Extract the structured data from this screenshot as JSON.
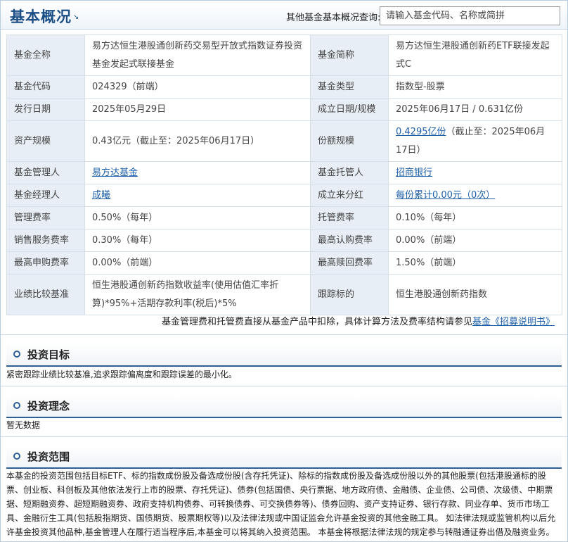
{
  "header": {
    "title": "基本概况",
    "title_arrow": "↘",
    "query_label": "其他基金基本概况查询:",
    "search_placeholder": "请输入基金代码、名称或简拼"
  },
  "info": {
    "full_name_label": "基金全称",
    "full_name": "易方达恒生港股通创新药交易型开放式指数证券投资基金发起式联接基金",
    "short_name_label": "基金简称",
    "short_name": "易方达恒生港股通创新药ETF联接发起式C",
    "code_label": "基金代码",
    "code": "024329（前端）",
    "type_label": "基金类型",
    "type": "指数型-股票",
    "issue_date_label": "发行日期",
    "issue_date": "2025年05月29日",
    "establish_label": "成立日期/规模",
    "establish": "2025年06月17日 / 0.631亿份",
    "asset_label": "资产规模",
    "asset": "0.43亿元（截止至：2025年06月17日）",
    "share_label": "份额规模",
    "share_link": "0.4295亿份",
    "share_suffix": "（截止至：2025年06月17日）",
    "manager_label": "基金管理人",
    "manager": "易方达基金",
    "custodian_label": "基金托管人",
    "custodian": "招商银行",
    "fund_manager_label": "基金经理人",
    "fund_manager": "成曦",
    "dividend_label": "成立来分红",
    "dividend": "每份累计0.00元（0次）",
    "mgmt_fee_label": "管理费率",
    "mgmt_fee": "0.50%（每年）",
    "custody_fee_label": "托管费率",
    "custody_fee": "0.10%（每年）",
    "sales_fee_label": "销售服务费率",
    "sales_fee": "0.30%（每年）",
    "max_subscribe_label": "最高认购费率",
    "max_subscribe": "0.00%（前端）",
    "max_purchase_label": "最高申购费率",
    "max_purchase": "0.00%（前端）",
    "max_redeem_label": "最高赎回费率",
    "max_redeem": "1.50%（前端）",
    "benchmark_label": "业绩比较基准",
    "benchmark": "恒生港股通创新药指数收益率(使用估值汇率折算)*95%+活期存款利率(税后)*5%",
    "tracking_label": "跟踪标的",
    "tracking": "恒生港股通创新药指数"
  },
  "note": {
    "text": "基金管理费和托管费直接从基金产品中扣除，具体计算方法及费率结构请参见",
    "link": "基金《招募说明书》"
  },
  "sections": {
    "goal_title": "投资目标",
    "goal_text": "紧密跟踪业绩比较基准,追求跟踪偏离度和跟踪误差的最小化。",
    "idea_title": "投资理念",
    "idea_text": "暂无数据",
    "scope_title": "投资范围",
    "scope_text": "本基金的投资范围包括目标ETF、标的指数成份股及备选成份股(含存托凭证)、除标的指数成份股及备选成份股以外的其他股票(包括港股通标的股票、创业板、科创板及其他依法发行上市的股票、存托凭证)、债券(包括国债、央行票据、地方政府债、金融债、企业债、公司债、次级债、中期票据、短期融资券、超短期融资券、政府支持机构债券、可转换债券、可交换债券等)、债券回购、资产支持证券、银行存款、同业存单、货币市场工具、金融衍生工具(包括股指期货、国债期货、股票期权等)以及法律法规或中国证监会允许基金投资的其他金融工具。 如法律法规或监管机构以后允许基金投资其他品种,基金管理人在履行适当程序后,本基金可以将其纳入投资范围。 本基金将根据法律法规的规定参与转融通证券出借及融资业务。"
  }
}
